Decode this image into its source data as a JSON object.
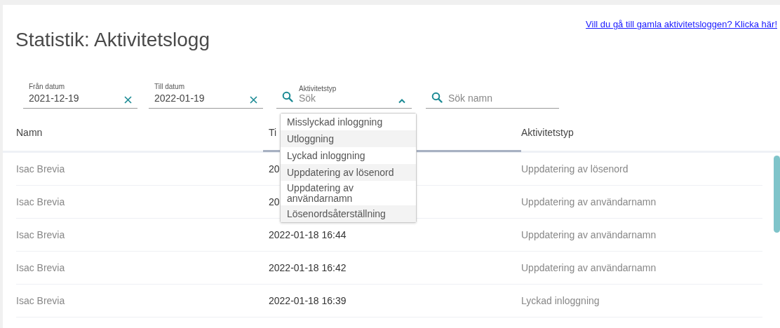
{
  "page": {
    "title": "Statistik: Aktivitetslogg",
    "old_log_link": "Vill du gå till gamla aktivitetsloggen? Klicka här!"
  },
  "filters": {
    "from_date": {
      "label": "Från datum",
      "value": "2021-12-19"
    },
    "to_date": {
      "label": "Till datum",
      "value": "2022-01-19"
    },
    "activity_type": {
      "label": "Aktivitetstyp",
      "placeholder": "Sök",
      "expanded": true,
      "options": [
        "Misslyckad inloggning",
        "Utloggning",
        "Lyckad inloggning",
        "Uppdatering av lösenord",
        "Uppdatering av användarnamn",
        "Lösenordsåterställning"
      ]
    },
    "name_search": {
      "placeholder": "Sök namn"
    }
  },
  "table": {
    "columns": [
      {
        "label": "Namn",
        "sorted": false
      },
      {
        "label": "Ti",
        "sorted": true
      },
      {
        "label": "Aktivitetstyp",
        "sorted": false
      }
    ],
    "rows": [
      [
        "Isac Brevia",
        "20",
        "Uppdatering av lösenord"
      ],
      [
        "Isac Brevia",
        "20",
        "Uppdatering av användarnamn"
      ],
      [
        "Isac Brevia",
        "2022-01-18 16:44",
        "Uppdatering av användarnamn"
      ],
      [
        "Isac Brevia",
        "2022-01-18 16:42",
        "Uppdatering av användarnamn"
      ],
      [
        "Isac Brevia",
        "2022-01-18 16:39",
        "Lyckad inloggning"
      ]
    ]
  }
}
